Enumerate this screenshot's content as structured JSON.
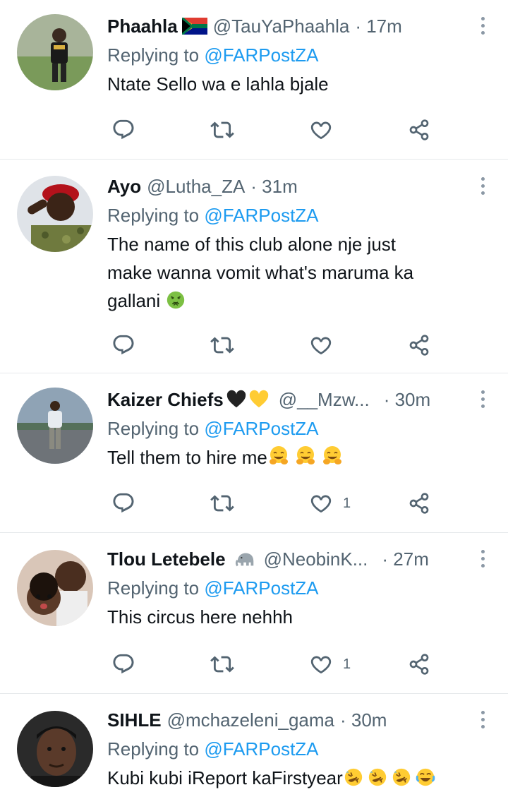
{
  "tweets": [
    {
      "name": "Phaahla",
      "flag": "South Africa flag",
      "handle": "@TauYaPhaahla",
      "time": "· 17m",
      "replying_prefix": "Replying to ",
      "replying_to": "@FARPostZA",
      "text": "Ntate Sello wa e lahla bjale",
      "likes": ""
    },
    {
      "name": "Ayo",
      "handle": "@Lutha_ZA",
      "time": "· 31m",
      "replying_prefix": "Replying to ",
      "replying_to": "@FARPostZA",
      "text_line1": "The name of this club alone nje just",
      "text_line2": "make wanna vomit what's maruma ka",
      "text_line3": "gallani",
      "likes": ""
    },
    {
      "name": "Kaizer Chiefs",
      "handle": "@__Mzw...",
      "time": "· 30m",
      "replying_prefix": "Replying to ",
      "replying_to": "@FARPostZA",
      "text": "Tell them to hire me",
      "likes": "1"
    },
    {
      "name": "Tlou Letebele",
      "handle": "@NeobinK...",
      "time": "· 27m",
      "replying_prefix": "Replying to ",
      "replying_to": "@FARPostZA",
      "text": "This circus here nehhh",
      "likes": "1"
    },
    {
      "name": "SIHLE",
      "handle": "@mchazeleni_gama",
      "time": "· 30m",
      "replying_prefix": "Replying to ",
      "replying_to": "@FARPostZA",
      "text": "Kubi kubi iReport kaFirstyear"
    }
  ],
  "colors": {
    "text": "#0f1419",
    "secondary": "#536471",
    "mention": "#1d9bf0",
    "divider": "#e6e9eb"
  },
  "icons": [
    "reply-icon",
    "retweet-icon",
    "like-icon",
    "share-icon",
    "more-icon"
  ]
}
